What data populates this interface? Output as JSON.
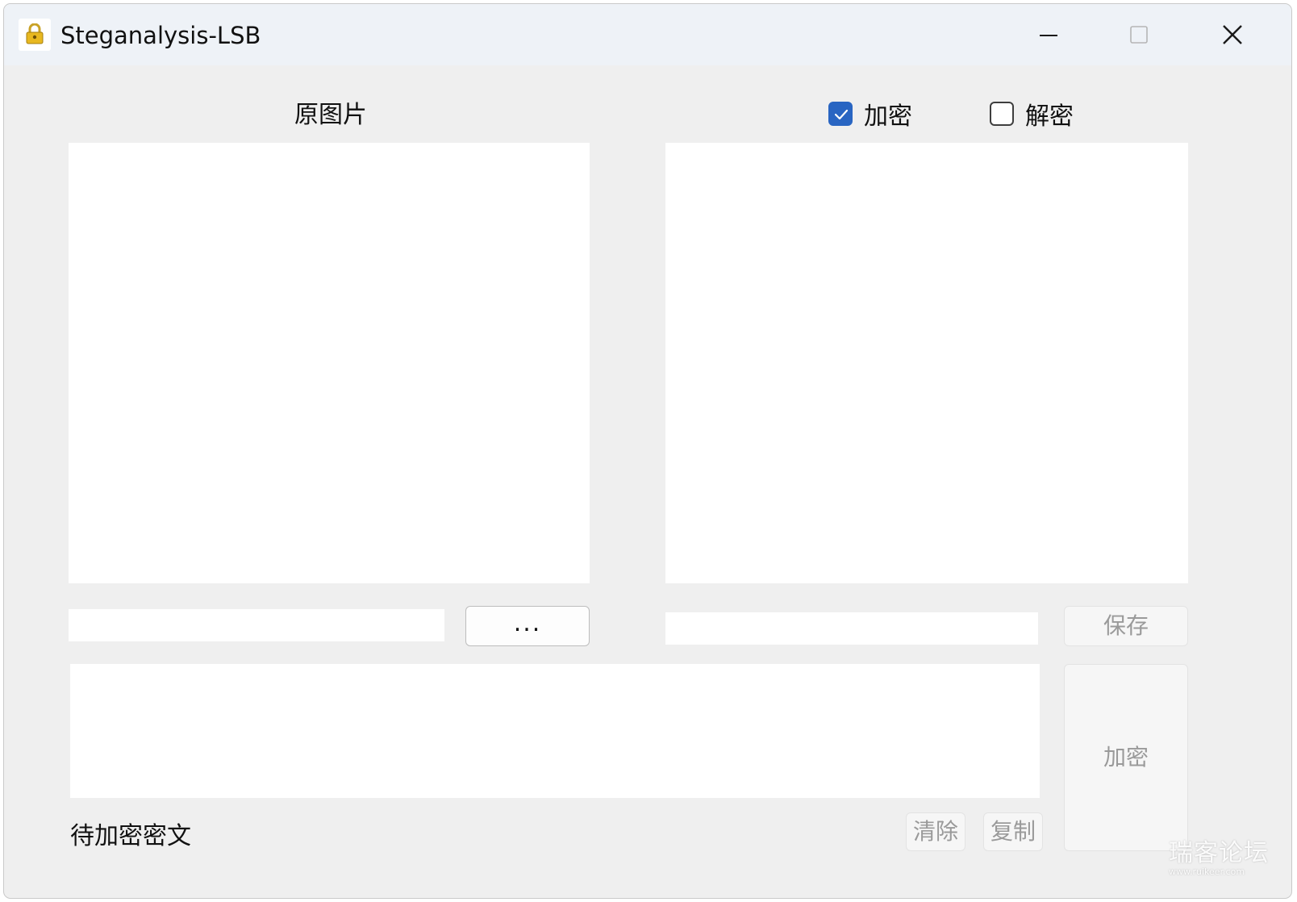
{
  "window": {
    "title": "Steganalysis-LSB",
    "app_icon": "lock-icon",
    "controls": [
      "minimize-icon",
      "maximize-icon",
      "close-icon"
    ]
  },
  "labels": {
    "original_image": "原图片",
    "plaintext": "待加密密文"
  },
  "mode": {
    "encrypt": {
      "label": "加密",
      "checked": true
    },
    "decrypt": {
      "label": "解密",
      "checked": false
    }
  },
  "inputs": {
    "original_path": "",
    "result_path": "",
    "plaintext": ""
  },
  "buttons": {
    "browse": "...",
    "save": "保存",
    "action": "加密",
    "clear": "清除",
    "copy": "复制"
  },
  "watermark": {
    "main": "瑞客论坛",
    "sub": "www.ruikeer.com"
  },
  "colors": {
    "checkbox_accent": "#2965c2",
    "window_bg": "#efefef",
    "titlebar_bg": "#eef2f7"
  }
}
